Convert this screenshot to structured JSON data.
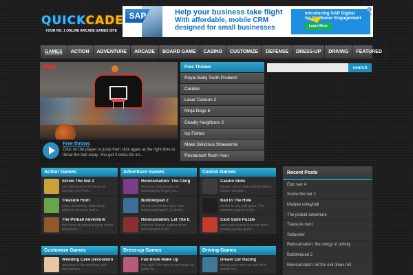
{
  "logo": {
    "part1": "QUICK",
    "part2": "CADE",
    "tagline": "YOUR NO. 1 ONLINE ARCADE GAMES SITE"
  },
  "ad": {
    "brand": "SAP",
    "headline_1": "Help your business take flight",
    "headline_2": "With affordable, mobile CRM",
    "headline_3": "designed for small businesses",
    "promo_1": "Introducing SAP Digital",
    "promo_2": "for Customer Engagement",
    "cta": "Learn More"
  },
  "nav": [
    "GAMES",
    "ACTION",
    "ADVENTURE",
    "ARCADE",
    "BOARD GAME",
    "CASINO",
    "CUSTOMIZE",
    "DEFENSE",
    "DRESS-UP",
    "DRIVING",
    "FEATURED"
  ],
  "featured": {
    "title": "Free throws",
    "description": "Click on the player to jump then click again at the right time to throw the ball away. You got 3 extra life an..."
  },
  "featured_list": [
    "Free Throws",
    "Royal Baby Tooth Problem",
    "Cardian",
    "Laser Cannon 2",
    "Ninja Dogs 6",
    "Deadly Neighbors 2",
    "Icy Fishes",
    "Make Delicious Shawarma",
    "Restaurant Rush Hour"
  ],
  "search": {
    "button": "search",
    "placeholder": ""
  },
  "panels": [
    {
      "title": "Action Games",
      "games": [
        {
          "name": "Screw The Nut 2",
          "desc": "you will become the best nut screwer ever! Let...",
          "color": "#c9a23d"
        },
        {
          "name": "Treasure Hunt",
          "desc": "jump, swimming, slide-head platform discover and e...",
          "color": "#6aa34a"
        },
        {
          "name": "The Pinball Adventure",
          "desc": "fun hours of pinball playing action. Adventure...",
          "color": "#8f5a2a"
        }
      ]
    },
    {
      "title": "Adventure Games",
      "games": [
        {
          "name": "Reincarnation: The Clerg",
          "desc": "And now reincarnation is unrestrained to get you...",
          "color": "#7a3d8a"
        },
        {
          "name": "Bubblequad 2",
          "desc": "All you remember save from bubblequad part 1 (1 level)...",
          "color": "#3d6e9a"
        },
        {
          "name": "Reincarnation: Let The E",
          "desc": "Help the demon capture three reincarnated in thi...",
          "color": "#8a2f2f"
        }
      ]
    },
    {
      "title": "Casino Games",
      "games": [
        {
          "name": "Casino Slots",
          "desc": "classic casino slot machine game, bonus rounded...",
          "color": "#3d3d3d"
        },
        {
          "name": "Ball In The Hole",
          "desc": "similar to any golf game. The awesome game to tell...",
          "color": "#1f1f1f"
        },
        {
          "name": "Card Suite Puzzle",
          "desc": "card suite puzzle is a new brain-teasing puzzle game...",
          "color": "#c73b2f"
        }
      ]
    },
    {
      "title": "Customize Games",
      "games": [
        {
          "name": "Wedding Cake Decoration",
          "desc": "welcome to the wedding cake decorations...",
          "color": "#e7c7a2"
        }
      ]
    },
    {
      "title": "Dress-up Games",
      "games": [
        {
          "name": "Fab Bride Make Up",
          "desc": "Hey girls! We have a new make up game for...",
          "color": "#b85a7a"
        }
      ]
    },
    {
      "title": "Driving Games",
      "games": [
        {
          "name": "Dream Car Racing",
          "desc": "design your own car and drive dream car...",
          "color": "#3d7a9a"
        }
      ]
    }
  ],
  "recent": {
    "title": "Recent Posts",
    "items": [
      "Epic war 4",
      "Screw the nut 2",
      "Madpet volleyball",
      "The pinball adventure",
      "Treasure hunt",
      "Solipskier",
      "Reincarnation: the clergy of unholy",
      "Bubblequad 2",
      "Reincarnation: let the evil times roll"
    ]
  }
}
